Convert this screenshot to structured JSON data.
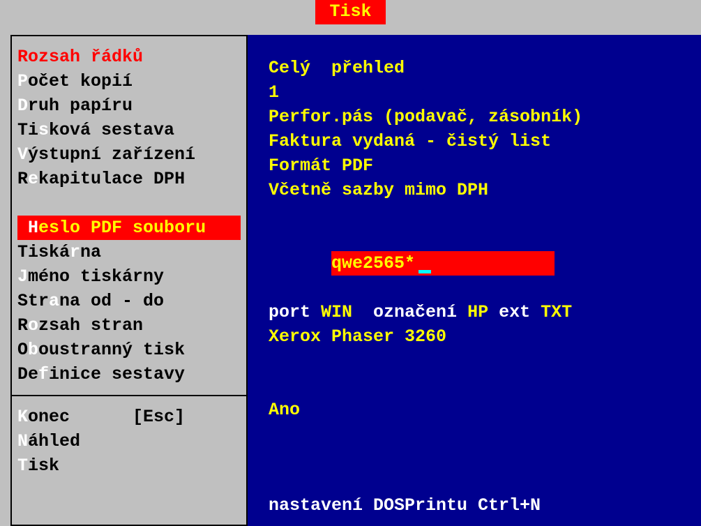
{
  "title": "Tisk",
  "menu": {
    "rozsah_radku": {
      "pre": "",
      "hot": "",
      "rest": "Rozsah řádků"
    },
    "pocet_kopii": {
      "pre": "",
      "hot": "P",
      "rest": "očet kopií"
    },
    "druh_papiru": {
      "pre": "",
      "hot": "D",
      "rest": "ruh papíru"
    },
    "tiskova_sestava": {
      "pre": "Ti",
      "hot": "s",
      "rest": "ková sestava"
    },
    "vystupni": {
      "pre": "",
      "hot": "V",
      "rest": "ýstupní zařízení"
    },
    "rekapitulace": {
      "pre": "R",
      "hot": "e",
      "rest": "kapitulace DPH"
    },
    "heslo_pdf": {
      "pre": "",
      "hot": "H",
      "rest": "eslo PDF souboru"
    },
    "tiskarna": {
      "pre": "Tiská",
      "hot": "r",
      "rest": "na"
    },
    "jmeno_tiskarny": {
      "pre": "",
      "hot": "J",
      "rest": "méno tiskárny"
    },
    "strana_od": {
      "pre": "Str",
      "hot": "a",
      "rest": "na od - do"
    },
    "rozsah_stran": {
      "pre": "R",
      "hot": "o",
      "rest": "zsah stran"
    },
    "oboustranny": {
      "pre": "O",
      "hot": "b",
      "rest": "oustranný tisk"
    },
    "definice": {
      "pre": "De",
      "hot": "f",
      "rest": "inice sestavy"
    },
    "konec": {
      "pre": "",
      "hot": "K",
      "rest": "onec      [Esc]"
    },
    "nahled": {
      "pre": "",
      "hot": "N",
      "rest": "áhled"
    },
    "tisk": {
      "pre": "",
      "hot": "T",
      "rest": "isk"
    }
  },
  "values": {
    "rozsah_radku": "Celý  přehled",
    "pocet_kopii": "1",
    "druh_papiru": "Perfor.pás (podavač, zásobník)",
    "tiskova_sestava": "Faktura vydaná - čistý list",
    "vystupni": "Formát PDF",
    "rekapitulace": "Včetně sazby mimo DPH",
    "heslo_pdf": "qwe2565*",
    "port_label": "port ",
    "port_val": "WIN",
    "oznaceni_label": "  označení ",
    "oznaceni_val": "HP",
    "ext_label": " ext ",
    "ext_val": "TXT",
    "jmeno_tiskarny": "Xerox Phaser 3260",
    "oboustranny": "Ano",
    "footer": "nastavení DOSPrintu Ctrl+N"
  }
}
